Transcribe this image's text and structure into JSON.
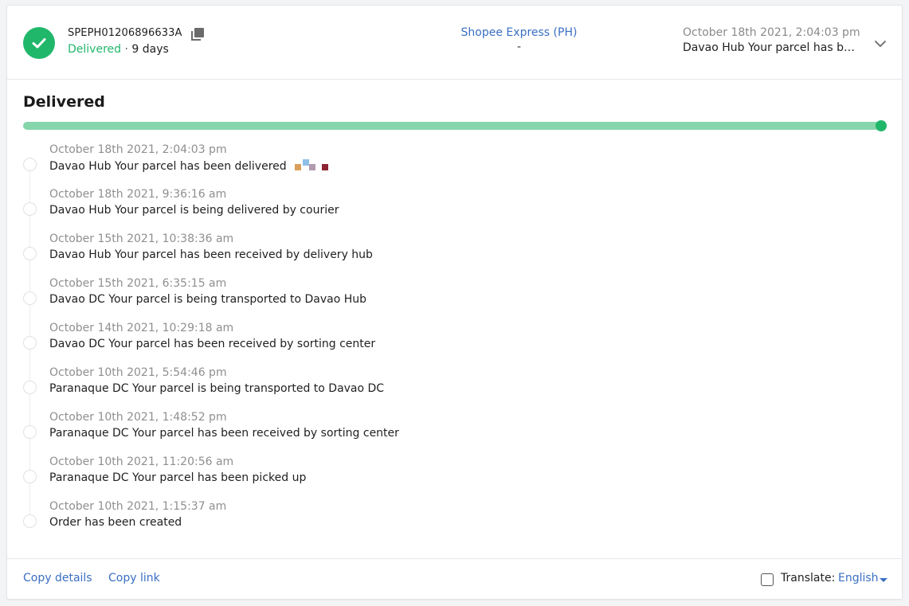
{
  "header": {
    "tracking_number": "SPEPH01206896633A",
    "status": "Delivered",
    "separator": "·",
    "duration": "9 days",
    "carrier_name": "Shopee Express (PH)",
    "carrier_sub": "-",
    "latest_time": "October 18th 2021, 2:04:03 pm",
    "latest_message": "Davao Hub Your parcel has been delivered",
    "status_color": "#21b76b",
    "link_color": "#3a6fc2",
    "icons": [
      "check-icon",
      "copy-icon",
      "chevron-down-icon"
    ]
  },
  "progress": {
    "title": "Delivered",
    "percent": 100
  },
  "events": [
    {
      "time": "October 18th 2021, 2:04:03 pm",
      "desc": "Davao Hub Your parcel has been delivered"
    },
    {
      "time": "October 18th 2021, 9:36:16 am",
      "desc": "Davao Hub Your parcel is being delivered by courier"
    },
    {
      "time": "October 15th 2021, 10:38:36 am",
      "desc": "Davao Hub Your parcel has been received by delivery hub"
    },
    {
      "time": "October 15th 2021, 6:35:15 am",
      "desc": "Davao DC Your parcel is being transported to Davao Hub"
    },
    {
      "time": "October 14th 2021, 10:29:18 am",
      "desc": "Davao DC Your parcel has been received by sorting center"
    },
    {
      "time": "October 10th 2021, 5:54:46 pm",
      "desc": "Paranaque DC Your parcel is being transported to Davao DC"
    },
    {
      "time": "October 10th 2021, 1:48:52 pm",
      "desc": "Paranaque DC Your parcel has been received by sorting center"
    },
    {
      "time": "October 10th 2021, 11:20:56 am",
      "desc": "Paranaque DC Your parcel has been picked up"
    },
    {
      "time": "October 10th 2021, 1:15:37 am",
      "desc": "Order has been created"
    }
  ],
  "footer": {
    "copy_details": "Copy details",
    "copy_link": "Copy link",
    "translate_label": "Translate:",
    "translate_language": "English"
  }
}
